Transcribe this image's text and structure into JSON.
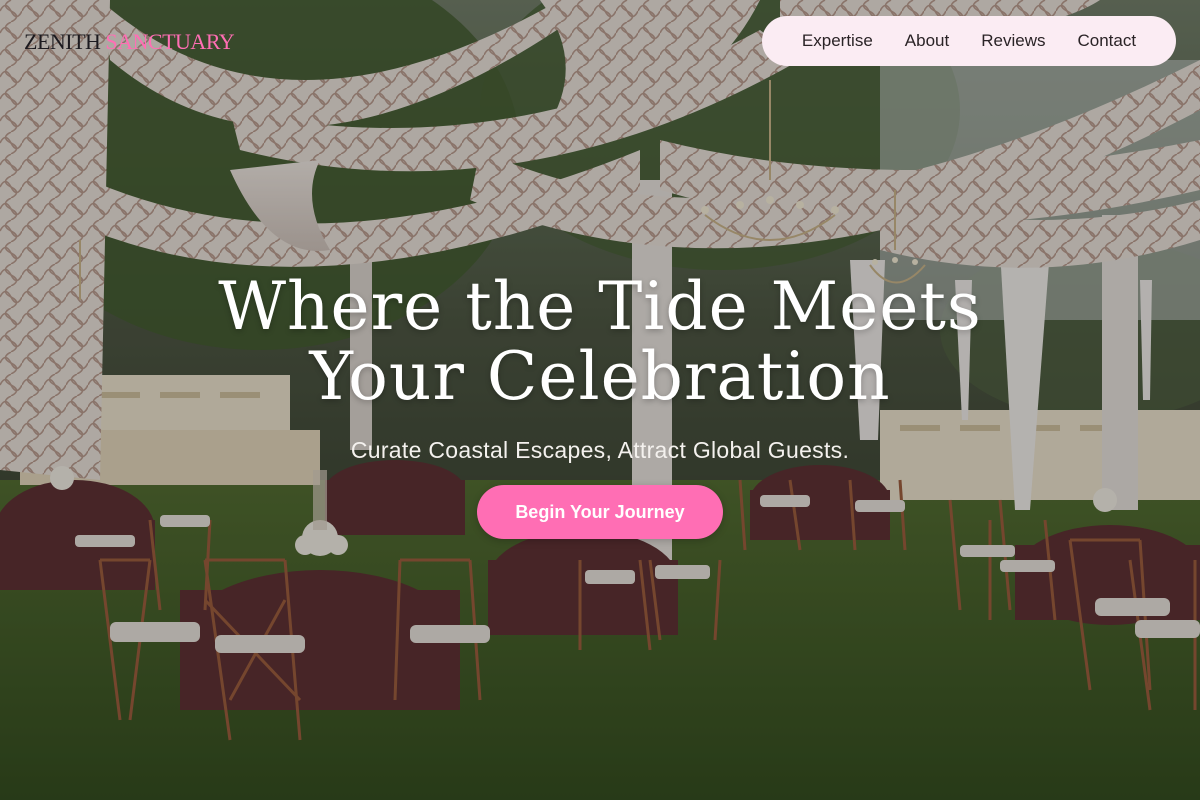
{
  "brand": {
    "name_part1": "ZENITH",
    "name_part2": "SANCTUARY",
    "accent_color": "#ff6eb4"
  },
  "nav": {
    "items": [
      {
        "label": "Expertise"
      },
      {
        "label": "About"
      },
      {
        "label": "Reviews"
      },
      {
        "label": "Contact"
      }
    ]
  },
  "hero": {
    "headline_line1": "Where the Tide Meets",
    "headline_line2": "Your Celebration",
    "subheadline": "Curate Coastal Escapes, Attract Global Guests.",
    "cta_label": "Begin Your Journey",
    "background_scene": "outdoor-wedding-venue-photo"
  }
}
